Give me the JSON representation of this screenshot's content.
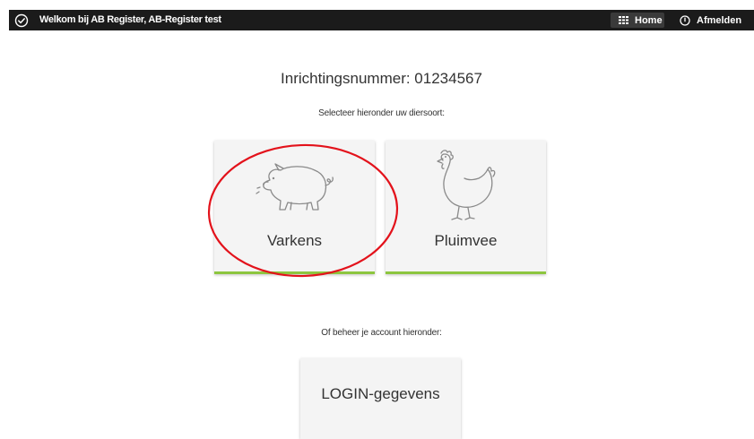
{
  "header": {
    "welcome_text": "Welkom bij AB Register, AB-Register test",
    "home_label": "Home",
    "logout_label": "Afmelden",
    "icons": {
      "brand": "check-circle-icon",
      "home": "grid-icon",
      "logout": "power-icon"
    }
  },
  "main": {
    "title": "Inrichtingsnummer: 01234567",
    "select_prompt": "Selecteer hieronder uw diersoort:",
    "species": [
      {
        "label": "Varkens",
        "icon": "pig-icon"
      },
      {
        "label": "Pluimvee",
        "icon": "chicken-icon"
      }
    ],
    "account_prompt": "Of beheer je account hieronder:",
    "account_tile_label": "LOGIN-gegevens"
  },
  "colors": {
    "topbar": "#1b1b1b",
    "tile_background": "#f4f4f4",
    "tile_accent": "#8dc63f",
    "highlight": "#e3121b"
  }
}
